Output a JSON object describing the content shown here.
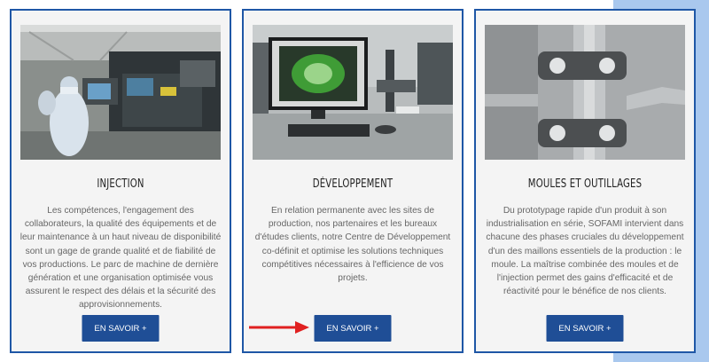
{
  "cards": [
    {
      "title": "INJECTION",
      "text": "Les compétences, l'engagement des collaborateurs, la qualité des équipements et de leur maintenance à un haut niveau de disponibilité sont un gage de grande qualité et de fiabilité de vos productions. Le parc de machine de dernière génération et une organisation optimisée vous assurent le respect des délais et la sécurité des approvisionnements.",
      "button": "EN SAVOIR +"
    },
    {
      "title": "DÉVELOPPEMENT",
      "text": "En relation permanente avec les sites de production, nos partenaires et les bureaux d'études clients, notre Centre de Développement co-définit et optimise les solutions techniques compétitives nécessaires à l'efficience de vos projets.",
      "button": "EN SAVOIR +"
    },
    {
      "title": "MOULES ET OUTILLAGES",
      "text": "Du prototypage rapide d'un produit à son industrialisation en série, SOFAMI intervient dans chacune des phases cruciales du développement d'un des maillons essentiels de la production : le moule. La maîtrise combinée des moules et de l'injection permet des gains d'efficacité et de réactivité pour le bénéfice de nos clients.",
      "button": "EN SAVOIR +"
    }
  ],
  "colors": {
    "border": "#1f57a6",
    "button": "#1f4e96",
    "accent_bg": "#a9c8ee",
    "arrow": "#e02020"
  }
}
